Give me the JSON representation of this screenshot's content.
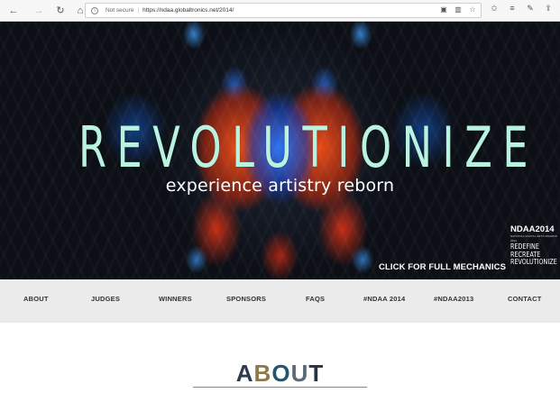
{
  "browser": {
    "security_label": "Not secure",
    "url": "https://ndaa.globaltronics.net/2014/",
    "back_icon": "←",
    "forward_icon": "→",
    "refresh_icon": "↻",
    "home_icon": "⌂"
  },
  "hero": {
    "title": "REVOLUTIONIZE",
    "subtitle": "experience artistry reborn",
    "cta": "CLICK FOR FULL MECHANICS",
    "brand": {
      "name": "NDAA2014",
      "tagline": "NATIONAL DIGITAL ARTS AWARDS 2014",
      "words": [
        "REDEFINE",
        "RECREATE",
        "REVOLUTIONIZE"
      ]
    }
  },
  "nav": {
    "items": [
      "ABOUT",
      "JUDGES",
      "WINNERS",
      "SPONSORS",
      "FAQS",
      "#NDAA 2014",
      "#NDAA2013",
      "CONTACT"
    ]
  },
  "about": {
    "heading_letters": [
      "A",
      "B",
      "O",
      "U",
      "T"
    ]
  },
  "colors": {
    "hero_title": "#b9f3df",
    "nav_bg": "#ebebeb",
    "nav_text": "#333333"
  }
}
